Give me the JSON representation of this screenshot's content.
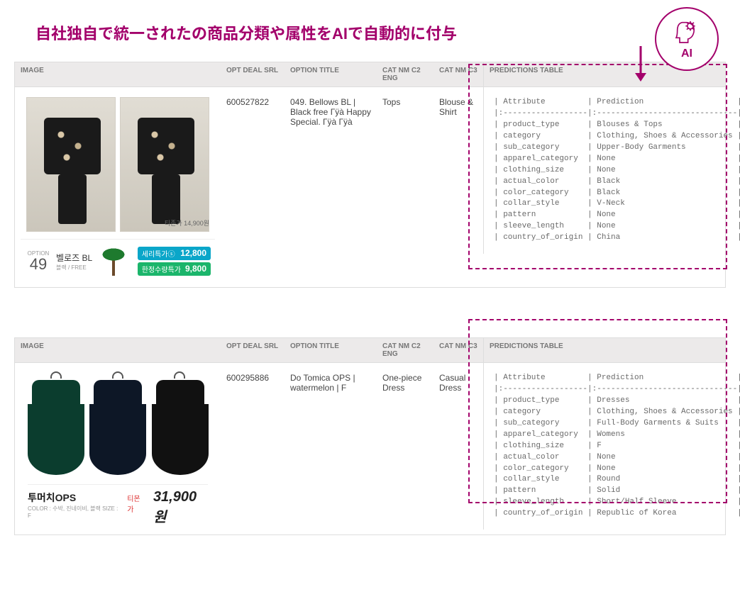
{
  "headline": "自社独自で統一されたの商品分類や属性をAIで自動的に付与",
  "ai_badge": {
    "label": "AI"
  },
  "columns": {
    "image": "IMAGE",
    "opt_deal_srl": "OPT DEAL SRL",
    "option_title": "OPTION TITLE",
    "cat_nm_c2_eng": "CAT NM C2 ENG",
    "cat_nm_c3": "CAT NM C3",
    "predictions_table": "PREDICTIONS TABLE"
  },
  "pred_headers": {
    "attribute": "Attribute",
    "prediction": "Prediction"
  },
  "rows": [
    {
      "opt_deal_srl": "600527822",
      "option_title": "049. Bellows BL | Black free Гÿà Happy Special. Гÿà Гÿà",
      "cat_c2_eng": "Tops",
      "cat_c3": "Blouse & Shirt",
      "promo": {
        "index_label": "OPTION",
        "index": "49",
        "name": "벨로즈 BL",
        "sub": "블랙 / FREE",
        "tiny_price": "티존가  14,900원",
        "pill1_label": "세리특가ⓢ",
        "pill1_price": "12,800",
        "pill2_label": "한정수량특가",
        "pill2_price": "9,800"
      },
      "predictions": [
        {
          "attr": "product_type",
          "val": "Blouses & Tops"
        },
        {
          "attr": "category",
          "val": "Clothing, Shoes & Accessories"
        },
        {
          "attr": "sub_category",
          "val": "Upper-Body Garments"
        },
        {
          "attr": "apparel_category",
          "val": "None"
        },
        {
          "attr": "clothing_size",
          "val": "None"
        },
        {
          "attr": "actual_color",
          "val": "Black"
        },
        {
          "attr": "color_category",
          "val": "Black"
        },
        {
          "attr": "collar_style",
          "val": "V-Neck"
        },
        {
          "attr": "pattern",
          "val": "None"
        },
        {
          "attr": "sleeve_length",
          "val": "None"
        },
        {
          "attr": "country_of_origin",
          "val": "China"
        }
      ]
    },
    {
      "opt_deal_srl": "600295886",
      "option_title": "Do Tomica OPS | watermelon | F",
      "cat_c2_eng": "One-piece Dress",
      "cat_c3": "Casual Dress",
      "caption": {
        "name": "투머치OPS",
        "sub": "COLOR : 수박, 진네이비, 블랙  SIZE : F",
        "price_label": "티몬가",
        "price": "31,900원"
      },
      "predictions": [
        {
          "attr": "product_type",
          "val": "Dresses"
        },
        {
          "attr": "category",
          "val": "Clothing, Shoes & Accessories"
        },
        {
          "attr": "sub_category",
          "val": "Full-Body Garments & Suits"
        },
        {
          "attr": "apparel_category",
          "val": "Womens"
        },
        {
          "attr": "clothing_size",
          "val": "F"
        },
        {
          "attr": "actual_color",
          "val": "None"
        },
        {
          "attr": "color_category",
          "val": "None"
        },
        {
          "attr": "collar_style",
          "val": "Round"
        },
        {
          "attr": "pattern",
          "val": "Solid"
        },
        {
          "attr": "sleeve_length",
          "val": "Short/Half Sleeve"
        },
        {
          "attr": "country_of_origin",
          "val": "Republic of Korea"
        }
      ]
    }
  ]
}
